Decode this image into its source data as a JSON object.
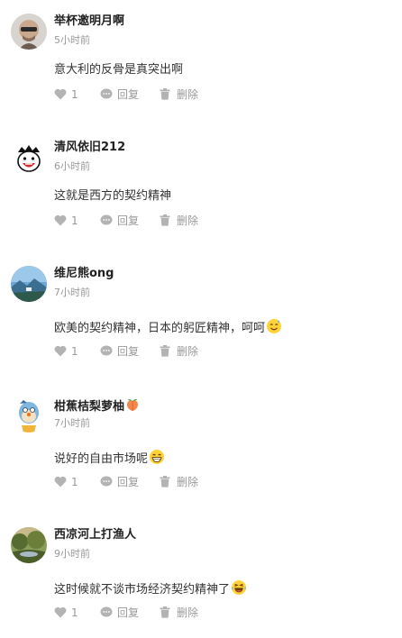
{
  "comments": [
    {
      "username": "举杯邀明月啊",
      "time": "5小时前",
      "text": "意大利的反骨是真突出啊",
      "emoji": "",
      "likes": "1",
      "reply_label": "回复",
      "delete_label": "删除",
      "avatar_icon": "avatar-man-sunglasses"
    },
    {
      "username": "清风依旧212",
      "time": "6小时前",
      "text": "这就是西方的契约精神",
      "emoji": "",
      "likes": "1",
      "reply_label": "回复",
      "delete_label": "删除",
      "avatar_icon": "avatar-cartoon-face"
    },
    {
      "username": "维尼熊ong",
      "time": "7小时前",
      "text": "欧美的契约精神，日本的躬匠精神，呵呵",
      "emoji": "sweat-smile-emoji",
      "likes": "1",
      "reply_label": "回复",
      "delete_label": "删除",
      "avatar_icon": "avatar-landscape"
    },
    {
      "username": "柑蕉桔梨萝柚",
      "username_emoji": "peach-emoji",
      "time": "7小时前",
      "text": "说好的自由市场呢",
      "emoji": "grin-emoji",
      "likes": "1",
      "reply_label": "回复",
      "delete_label": "删除",
      "avatar_icon": "avatar-cartoon-character"
    },
    {
      "username": "西凉河上打渔人",
      "time": "9小时前",
      "text": "这时候就不谈市场经济契约精神了",
      "emoji": "laugh-tears-emoji",
      "likes": "1",
      "reply_label": "回复",
      "delete_label": "删除",
      "avatar_icon": "avatar-nature"
    }
  ],
  "colors": {
    "meta": "#999999",
    "text": "#333333",
    "username": "#222222",
    "icon": "#b3b3b3"
  }
}
